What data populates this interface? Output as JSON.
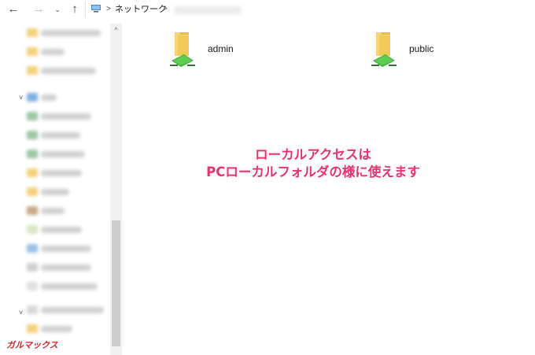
{
  "address_bar": {
    "back_glyph": "←",
    "forward_glyph": "→",
    "recent_glyph": "⌄",
    "up_glyph": "↑",
    "separator": ">",
    "location": "ネットワーク"
  },
  "nav_pane": {
    "expand_glyph": "˅",
    "scroll_up_glyph": "^"
  },
  "items": [
    {
      "name": "admin",
      "icon": "network-share-folder-icon"
    },
    {
      "name": "public",
      "icon": "network-share-folder-icon"
    }
  ],
  "annotation": {
    "line1": "ローカルアクセスは",
    "line2": "PCローカルフォルダの様に使えます",
    "color": "#e8336e"
  },
  "watermark": {
    "text": "ガルマックス",
    "color": "#d8232a"
  }
}
